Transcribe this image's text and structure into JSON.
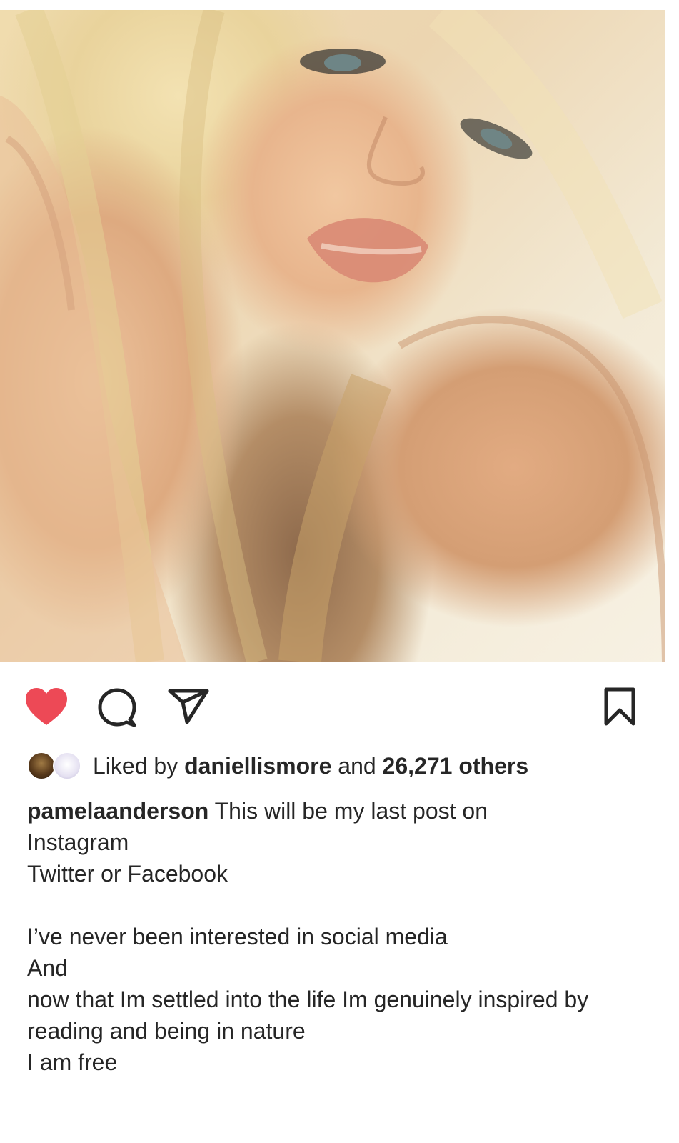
{
  "post": {
    "username": "pamelaanderson",
    "likes": {
      "prefix": "Liked by",
      "user": "daniellismore",
      "middle": "and",
      "count": "26,271 others"
    },
    "caption_first": "This will be my last post on",
    "caption_lines": [
      "Instagram",
      "Twitter or Facebook",
      "",
      "I’ve never been interested in social media",
      "And",
      "now that  Im settled into the life Im genuinely inspired by",
      "reading and being in nature",
      "I am free"
    ],
    "liked": true
  },
  "icons": {
    "like": "heart-icon",
    "comment": "comment-icon",
    "share": "send-icon",
    "save": "bookmark-icon"
  },
  "colors": {
    "heart": "#ed4956",
    "text": "#262626",
    "icon": "#262626"
  }
}
